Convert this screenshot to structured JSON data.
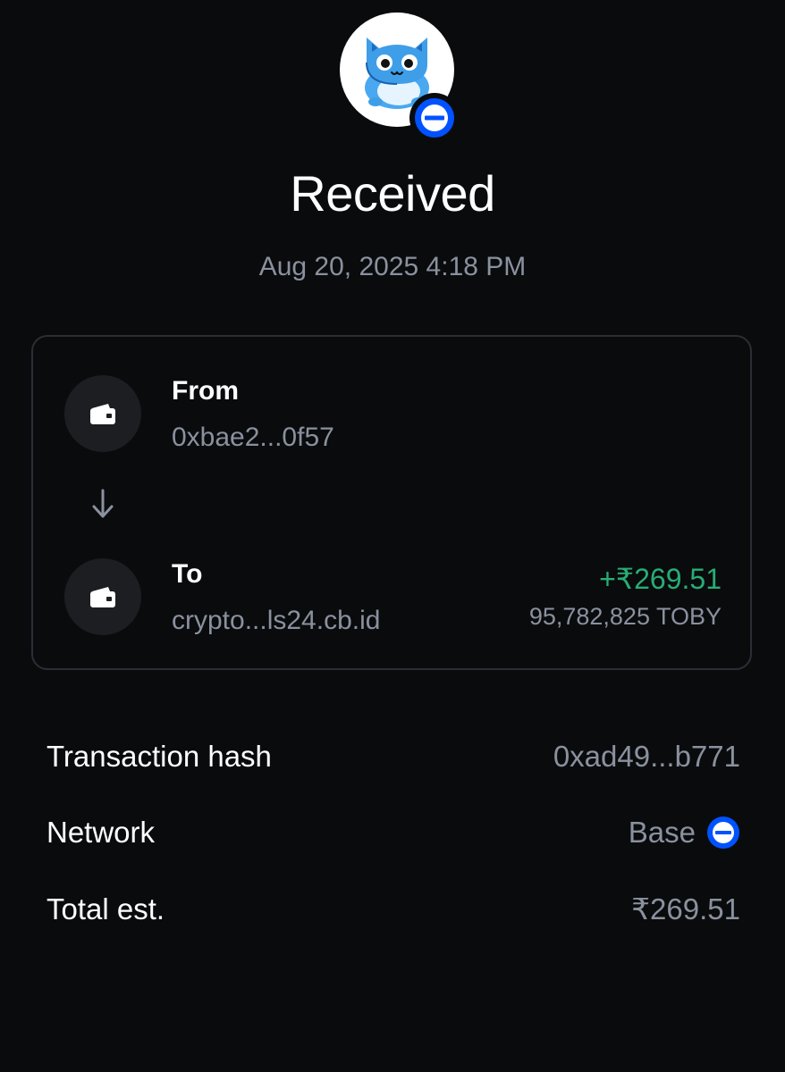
{
  "header": {
    "title": "Received",
    "date": "Aug 20, 2025 4:18 PM",
    "token_avatar": "toby-cat-avatar",
    "network_badge_icon": "base-network-icon"
  },
  "transfer": {
    "from": {
      "label": "From",
      "address": "0xbae2...0f57",
      "icon": "wallet-icon"
    },
    "arrow_icon": "arrow-down-icon",
    "to": {
      "label": "To",
      "address": "crypto...ls24.cb.id",
      "icon": "wallet-icon"
    },
    "amount_fiat": "+₹269.51",
    "amount_token": "95,782,825 TOBY"
  },
  "details": {
    "hash_label": "Transaction hash",
    "hash_value": "0xad49...b771",
    "network_label": "Network",
    "network_value": "Base",
    "total_label": "Total est.",
    "total_value": "₹269.51"
  },
  "colors": {
    "background": "#0a0b0d",
    "positive": "#27ad75",
    "muted_text": "#8a919e",
    "base_blue": "#0052ff"
  }
}
